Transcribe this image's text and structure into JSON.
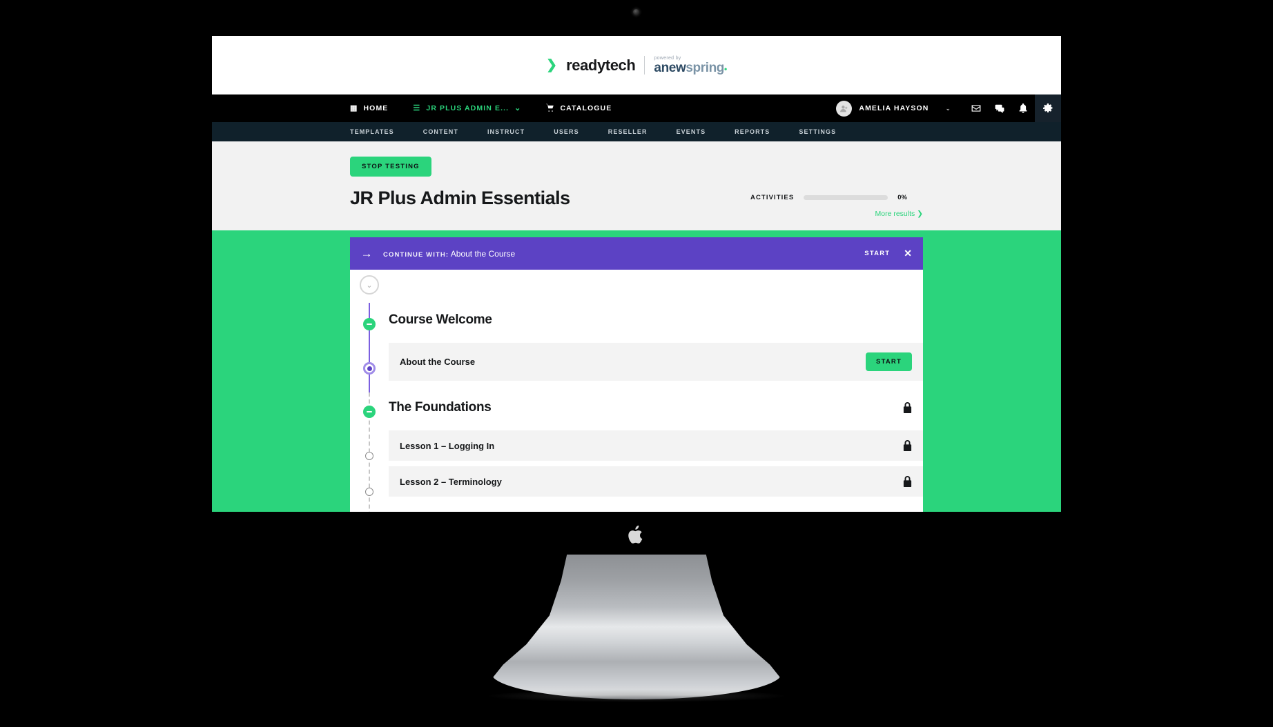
{
  "brand": {
    "mark": "❯",
    "name": "readytech",
    "powered_by": "powered by",
    "product_a": "anew",
    "product_b": "spring",
    "dot": "•"
  },
  "mainnav": {
    "items": [
      {
        "label": "HOME",
        "icon": "grid-icon",
        "glyph": "▦",
        "active": false
      },
      {
        "label": "JR PLUS ADMIN E...",
        "icon": "list-icon",
        "glyph": "☰",
        "active": true
      },
      {
        "label": "CATALOGUE",
        "icon": "cart-icon",
        "glyph": "🛒",
        "active": false
      }
    ],
    "user": "AMELIA HAYSON",
    "chevron": "⌄",
    "icons": [
      "mail-icon",
      "chat-icon",
      "bell-icon",
      "gear-icon"
    ]
  },
  "subnav": {
    "items": [
      "TEMPLATES",
      "CONTENT",
      "INSTRUCT",
      "USERS",
      "RESELLER",
      "EVENTS",
      "REPORTS",
      "SETTINGS"
    ]
  },
  "header": {
    "stop_testing": "STOP TESTING",
    "course_title": "JR Plus Admin Essentials",
    "activities_label": "ACTIVITIES",
    "activities_percent": "0%",
    "activities_value": 0,
    "more_results": "More results",
    "more_results_chevron": "❯"
  },
  "continue_bar": {
    "arrow": "→",
    "label": "CONTINUE WITH:",
    "item": "About the Course",
    "start": "START",
    "close": "✕",
    "color": "#5c42c4"
  },
  "timeline": {
    "collapse_chevron": "⌄",
    "sections": [
      {
        "title": "Course Welcome",
        "node": "minus",
        "locked": false,
        "lessons": [
          {
            "title": "About the Course",
            "node": "current",
            "action": "START",
            "locked": false
          }
        ]
      },
      {
        "title": "The Foundations",
        "node": "minus",
        "locked": true,
        "lessons": [
          {
            "title": "Lesson 1 – Logging In",
            "node": "hollow",
            "action": null,
            "locked": true
          },
          {
            "title": "Lesson 2 – Terminology",
            "node": "hollow",
            "action": null,
            "locked": true
          }
        ]
      }
    ]
  },
  "colors": {
    "accent_green": "#2bd47c",
    "purple": "#5c42c4",
    "nav_black": "#000000",
    "subnav_navy": "#10212b",
    "page_bg": "#f2f2f2"
  }
}
